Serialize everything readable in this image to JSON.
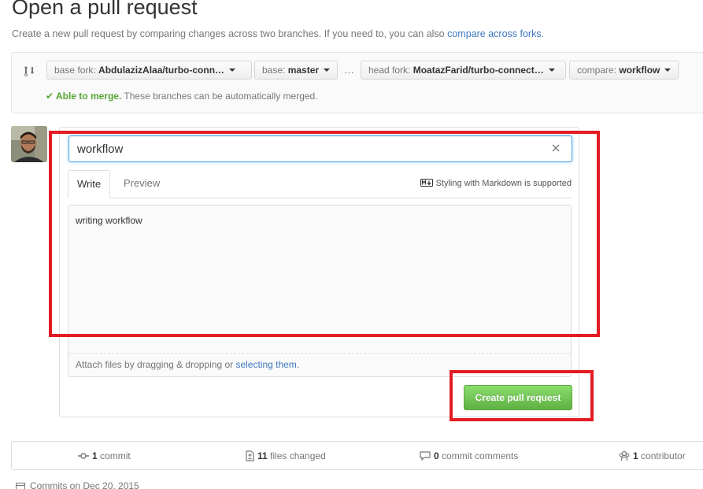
{
  "header": {
    "title": "Open a pull request",
    "subtitle": "Create a new pull request by comparing changes across two branches. If you need to, you can also",
    "subtitle_link": "compare across forks",
    "subtitle_end": "."
  },
  "range": {
    "base_fork_label": "base fork:",
    "base_fork_value": "AbdulazizAlaa/turbo-conn…",
    "base_label": "base:",
    "base_value": "master",
    "ellipsis": "…",
    "head_fork_label": "head fork:",
    "head_fork_value": "MoatazFarid/turbo-connect…",
    "compare_label": "compare:",
    "compare_value": "workflow",
    "merge_ok": "✔ Able to merge.",
    "merge_text": "These branches can be automatically merged."
  },
  "form": {
    "title_value": "workflow",
    "tab_write": "Write",
    "tab_preview": "Preview",
    "markdown_note": "Styling with Markdown is supported",
    "body_text": "writing workflow",
    "attach_text": "Attach files by dragging & dropping or",
    "attach_link": "selecting them",
    "attach_end": ".",
    "submit_label": "Create pull request"
  },
  "summary": {
    "commits_count": "1",
    "commits_label": "commit",
    "files_count": "11",
    "files_label": "files changed",
    "comments_count": "0",
    "comments_label": "commit comments",
    "contributors_count": "1",
    "contributors_label": "contributor"
  },
  "commits_on": "Commits on Dec 20, 2015",
  "colors": {
    "accent_link": "#4078c0",
    "success": "#55a532",
    "button_green": "#60b044",
    "annotation_red": "#e31b23",
    "focus_blue": "#51a7e8"
  },
  "icons": [
    "git-compare-icon",
    "check-icon",
    "clear-icon",
    "markdown-icon",
    "commit-icon",
    "diff-icon",
    "comment-icon",
    "organization-icon",
    "calendar-icon"
  ]
}
